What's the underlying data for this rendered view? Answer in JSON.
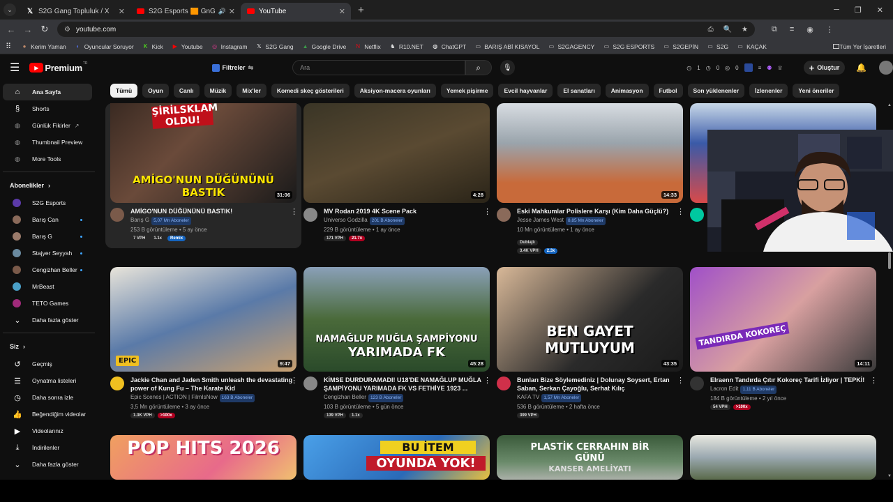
{
  "browser": {
    "tabs": [
      {
        "title": "S2G Gang Topluluk / X",
        "icon": "x-icon"
      },
      {
        "title": "S2G Esports 🟧 GnG Esports",
        "icon": "youtube-icon"
      },
      {
        "title": "YouTube",
        "icon": "youtube-icon"
      }
    ],
    "url": "youtube.com",
    "bookmarks": [
      "Kerim Yaman",
      "Oyuncular Soruyor",
      "Kick",
      "Youtube",
      "Instagram",
      "S2G Gang",
      "Google Drive",
      "Netflix",
      "R10.NET",
      "ChatGPT",
      "BARIŞ ABİ KISAYOL",
      "S2GAGENCY",
      "S2G ESPORTS",
      "S2GEPİN",
      "S2G",
      "KAÇAK"
    ],
    "all_bookmarks": "Tüm Yer İşaretleri"
  },
  "masthead": {
    "logo": "Premium",
    "logo_sup": "TR",
    "filters": "Filtreler",
    "search_placeholder": "Ara",
    "stats": [
      "1",
      "0",
      "0"
    ],
    "create": "Oluştur"
  },
  "chips": [
    "Tümü",
    "Oyun",
    "Canlı",
    "Müzik",
    "Mix'ler",
    "Komedi skeç gösterileri",
    "Aksiyon-macera oyunları",
    "Yemek pişirme",
    "Evcil hayvanlar",
    "El sanatları",
    "Animasyon",
    "Futbol",
    "Son yüklenenler",
    "İzlenenler",
    "Yeni öneriler"
  ],
  "sidebar": {
    "main": [
      {
        "label": "Ana Sayfa",
        "icon": "home-icon"
      },
      {
        "label": "Shorts",
        "icon": "shorts-icon"
      },
      {
        "label": "Günlük Fikirler",
        "icon": "extension-icon"
      },
      {
        "label": "Thumbnail Preview",
        "icon": "extension-icon"
      },
      {
        "label": "More Tools",
        "icon": "extension-icon"
      }
    ],
    "subs_title": "Abonelikler",
    "subs": [
      {
        "label": "S2G Esports",
        "color": "#5b3aa8",
        "dot": false
      },
      {
        "label": "Barış Can",
        "color": "#8a6a5a",
        "dot": true
      },
      {
        "label": "Barış G",
        "color": "#9a7a6a",
        "dot": true
      },
      {
        "label": "Stajyer Seyyah",
        "color": "#6a8aa0",
        "dot": true
      },
      {
        "label": "Cengizhan Beller",
        "color": "#7a5a4a",
        "dot": true
      },
      {
        "label": "MrBeast",
        "color": "#4aa0c8",
        "dot": false
      },
      {
        "label": "TETO Games",
        "color": "#a02a7a",
        "dot": false
      }
    ],
    "show_more": "Daha fazla göster",
    "you_title": "Siz",
    "you": [
      {
        "label": "Geçmiş",
        "icon": "history-icon"
      },
      {
        "label": "Oynatma listeleri",
        "icon": "playlist-icon"
      },
      {
        "label": "Daha sonra izle",
        "icon": "clock-icon"
      },
      {
        "label": "Beğendiğim videolar",
        "icon": "like-icon"
      },
      {
        "label": "Videolarınız",
        "icon": "video-icon"
      },
      {
        "label": "İndirilenler",
        "icon": "download-icon"
      }
    ],
    "show_more2": "Daha fazla göster"
  },
  "videos": [
    {
      "title": "AMİGO'NUN DÜĞÜNÜNÜ BASTIK!",
      "channel": "Barış G",
      "subs": "5,07 Mn Aboneler",
      "views": "253 B görüntüleme • 5 ay önce",
      "duration": "31:06",
      "badges": [
        "7 VPH",
        "1.1x",
        "Remix"
      ],
      "thumb_text": "AMİGO'NUN DÜĞÜNÜNÜ BASTIK",
      "thumb_top": "ŞİRİLSKLAM OLDU!"
    },
    {
      "title": "MV Rodan 2019 4K Scene Pack",
      "channel": "Universo Godzilla",
      "subs": "201 B Aboneler",
      "views": "229 B görüntüleme • 1 ay önce",
      "duration": "4:28",
      "badges": [
        "171 VPH",
        "21.7x"
      ]
    },
    {
      "title": "Eski Mahkumlar Polislere Karşı (Kim Daha Güçlü?)",
      "channel": "Jesse James West",
      "subs": "8,85 Mn Aboneler",
      "views": "10 Mn görüntüleme • 1 ay önce",
      "duration": "14:33",
      "extra": "Dublajlı",
      "badges": [
        "3.4K VPH",
        "2.3x"
      ]
    },
    {
      "title": "",
      "channel": "",
      "subs": "",
      "views": "",
      "duration": "",
      "badges": []
    },
    {
      "title": "Jackie Chan and Jaden Smith unleash the devastating power of Kung Fu – The Karate Kid",
      "channel": "Epic Scenes | ACTION | FilmIsNow",
      "subs": "163 B Aboneler",
      "views": "3,5 Mn görüntüleme • 3 ay önce",
      "duration": "9:47",
      "badges": [
        "1.3K VPH",
        ">100x"
      ],
      "thumb_text": "EPIC"
    },
    {
      "title": "KİMSE DURDURAMADI! U18'DE NAMAĞLUP MUĞLA ŞAMPİYONU YARIMADA FK VS FETHİYE 1923 ...",
      "channel": "Cengizhan Beller",
      "subs": "123 B Aboneler",
      "views": "103 B görüntüleme • 5 gün önce",
      "duration": "45:28",
      "badges": [
        "139 VPH",
        "1.1x"
      ],
      "thumb_text": "NAMAĞLUP MUĞLA ŞAMPİYONU",
      "thumb_text2": "YARIMADA FK"
    },
    {
      "title": "Bunları Bize Söylemediniz | Dolunay Soysert, Ertan Saban, Serkan Çayoğlu, Serhat Kılıç",
      "channel": "KAFA TV",
      "subs": "1,57 Mn Aboneler",
      "views": "536 B görüntüleme • 2 hafta önce",
      "duration": "43:35",
      "badges": [
        "399 VPH"
      ],
      "thumb_text": "BEN GAYET",
      "thumb_text2": "MUTLUYUM"
    },
    {
      "title": "Elraenn Tandırda Çıtır Kokoreç Tarifi İzliyor | TEPKİ!",
      "channel": "Lacron Edit",
      "subs": "1,11 B Aboneler",
      "views": "184 B görüntüleme • 2 yıl önce",
      "duration": "14:11",
      "badges": [
        "54 VPH",
        ">100x"
      ],
      "thumb_text": "TANDIRDA KOKOREÇ"
    },
    {
      "thumb_text": "POP HITS 2026"
    },
    {
      "thumb_text": "BU İTEM",
      "thumb_text2": "OYUNDA YOK!"
    },
    {
      "thumb_text": "PLASTİK CERRAHIN BİR",
      "thumb_text2": "GÜNÜ",
      "thumb_text3": "KANSER AMELİYATI"
    },
    {}
  ]
}
